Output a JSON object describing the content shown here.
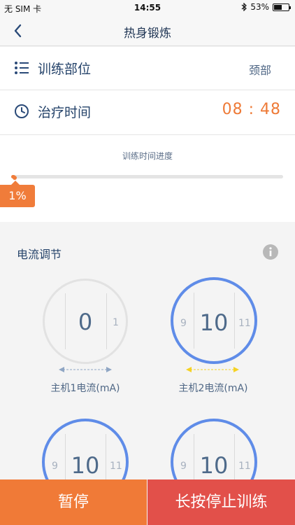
{
  "status_bar": {
    "carrier": "无 SIM 卡",
    "time": "14:55",
    "battery": "53%",
    "battery_level": 0.53
  },
  "nav": {
    "title": "热身锻炼"
  },
  "rows": {
    "part": {
      "label": "训练部位",
      "value": "颈部"
    },
    "duration": {
      "label": "治疗时间",
      "value": "08 : 48"
    }
  },
  "progress": {
    "title": "训练时间进度",
    "percent_label": "1%",
    "value": 0.01
  },
  "current": {
    "title": "电流调节",
    "dials": [
      {
        "prev": "",
        "value": "0",
        "next": "1",
        "label": "主机1电流(mA)"
      },
      {
        "prev": "9",
        "value": "10",
        "next": "11",
        "label": "主机2电流(mA)"
      },
      {
        "prev": "9",
        "value": "10",
        "next": "11",
        "label": ""
      },
      {
        "prev": "9",
        "value": "10",
        "next": "11",
        "label": ""
      }
    ]
  },
  "buttons": {
    "pause": "暂停",
    "stop": "长按停止训练"
  },
  "colors": {
    "accent_orange": "#f07a37",
    "stop_red": "#e2504a",
    "dial_blue": "#5f8ce8",
    "arrow_yellow": "#f5d224",
    "arrow_blue": "#8fa6c4"
  }
}
